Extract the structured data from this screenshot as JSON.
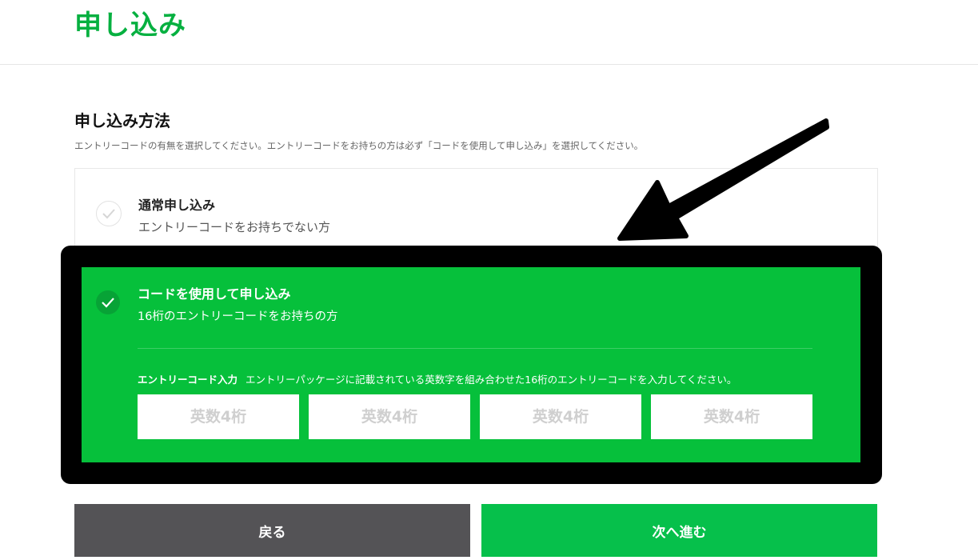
{
  "header": {
    "title": "申し込み"
  },
  "section": {
    "title": "申し込み方法",
    "description": "エントリーコードの有無を選択してください。エントリーコードをお持ちの方は必ず「コードを使用して申し込み」を選択してください。"
  },
  "options": [
    {
      "title": "通常申し込み",
      "subtitle": "エントリーコードをお持ちでない方",
      "selected": false
    },
    {
      "title": "コードを使用して申し込み",
      "subtitle": "16桁のエントリーコードをお持ちの方",
      "selected": true
    }
  ],
  "entry": {
    "label": "エントリーコード入力",
    "hint": "エントリーパッケージに記載されている英数字を組み合わせた16桁のエントリーコードを入力してください。",
    "inputs": [
      {
        "placeholder": "英数4桁",
        "value": ""
      },
      {
        "placeholder": "英数4桁",
        "value": ""
      },
      {
        "placeholder": "英数4桁",
        "value": ""
      },
      {
        "placeholder": "英数4桁",
        "value": ""
      }
    ]
  },
  "buttons": {
    "back": "戻る",
    "next": "次へ進む"
  },
  "colors": {
    "brand_green": "#06c755",
    "selected_bg": "#06c03b",
    "back_button": "#545356",
    "highlight_frame": "#000000",
    "annotation_arrow": "#000000"
  },
  "icons": {
    "check": "check-icon",
    "annotation": "arrow-icon"
  }
}
